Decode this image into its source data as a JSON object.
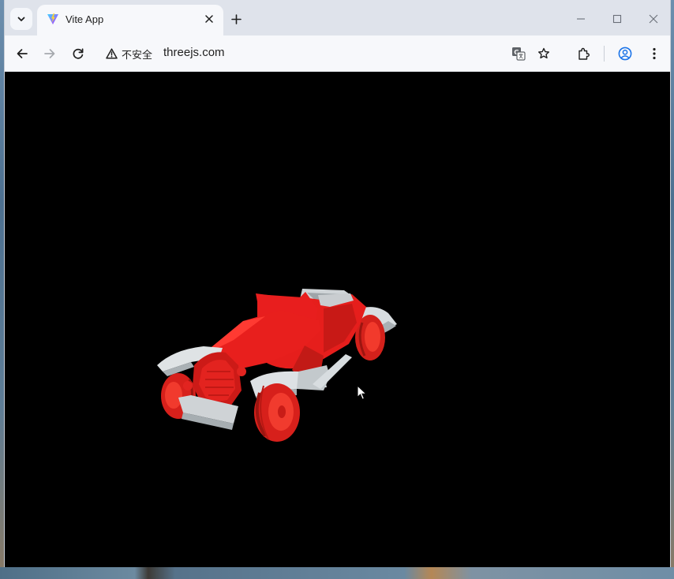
{
  "browser": {
    "tab": {
      "title": "Vite App",
      "favicon": "vite-logo-icon"
    },
    "address_bar": {
      "security_label": "不安全",
      "url": "threejs.com"
    },
    "icons": {
      "tab_search": "chevron-down-icon",
      "tab_close": "close-icon",
      "new_tab": "plus-icon",
      "back": "arrow-left-icon",
      "forward": "arrow-right-icon",
      "reload": "reload-icon",
      "warning": "warning-icon",
      "translate": "translate-icon",
      "bookmark": "star-icon",
      "extensions": "puzzle-icon",
      "profile": "profile-icon",
      "menu": "kebab-menu-icon",
      "minimize": "minimize-icon",
      "maximize": "maximize-icon",
      "close_window": "close-window-icon"
    }
  },
  "scene": {
    "background": "#000000",
    "model": "red vintage roadster car",
    "colors": {
      "body": "#e8201e",
      "body_shadow": "#b11414",
      "trim": "#d8dde0",
      "trim_shadow": "#a9b0b4"
    }
  }
}
